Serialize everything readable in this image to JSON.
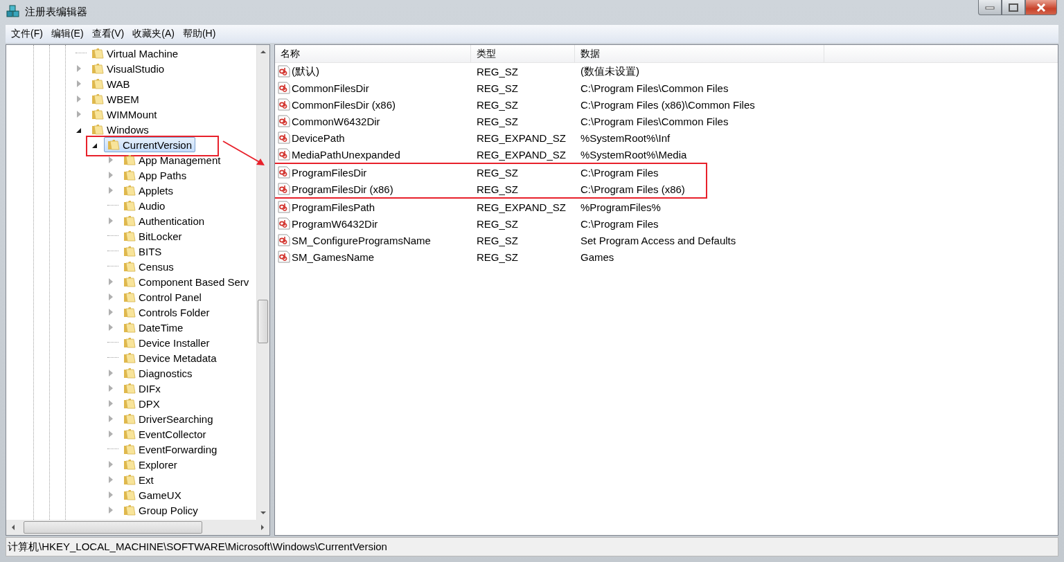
{
  "window": {
    "title": "注册表编辑器"
  },
  "menu": [
    "文件(F)",
    "编辑(E)",
    "查看(V)",
    "收藏夹(A)",
    "帮助(H)"
  ],
  "tree": [
    {
      "label": "Virtual Machine",
      "has_children": false,
      "selected": false,
      "marked": false
    },
    {
      "label": "VisualStudio",
      "has_children": true,
      "expanded": false,
      "selected": false,
      "marked": false
    },
    {
      "label": "WAB",
      "has_children": true,
      "expanded": false,
      "selected": false,
      "marked": false
    },
    {
      "label": "WBEM",
      "has_children": true,
      "expanded": false,
      "selected": false,
      "marked": false
    },
    {
      "label": "WIMMount",
      "has_children": true,
      "expanded": false,
      "selected": false,
      "marked": false
    },
    {
      "label": "Windows",
      "has_children": true,
      "expanded": true,
      "selected": false,
      "marked": false,
      "children": [
        {
          "label": "CurrentVersion",
          "has_children": true,
          "expanded": true,
          "selected": true,
          "marked": true,
          "children": [
            {
              "label": "App Management",
              "has_children": true,
              "expanded": false,
              "selected": false,
              "marked": false
            },
            {
              "label": "App Paths",
              "has_children": true,
              "expanded": false,
              "selected": false,
              "marked": false
            },
            {
              "label": "Applets",
              "has_children": true,
              "expanded": false,
              "selected": false,
              "marked": false
            },
            {
              "label": "Audio",
              "has_children": false,
              "selected": false,
              "marked": false
            },
            {
              "label": "Authentication",
              "has_children": true,
              "expanded": false,
              "selected": false,
              "marked": false
            },
            {
              "label": "BitLocker",
              "has_children": false,
              "selected": false,
              "marked": false
            },
            {
              "label": "BITS",
              "has_children": false,
              "selected": false,
              "marked": false
            },
            {
              "label": "Census",
              "has_children": false,
              "selected": false,
              "marked": false
            },
            {
              "label": "Component Based Serv",
              "has_children": true,
              "expanded": false,
              "selected": false,
              "marked": false
            },
            {
              "label": "Control Panel",
              "has_children": true,
              "expanded": false,
              "selected": false,
              "marked": false
            },
            {
              "label": "Controls Folder",
              "has_children": true,
              "expanded": false,
              "selected": false,
              "marked": false
            },
            {
              "label": "DateTime",
              "has_children": true,
              "expanded": false,
              "selected": false,
              "marked": false
            },
            {
              "label": "Device Installer",
              "has_children": false,
              "selected": false,
              "marked": false
            },
            {
              "label": "Device Metadata",
              "has_children": false,
              "selected": false,
              "marked": false
            },
            {
              "label": "Diagnostics",
              "has_children": true,
              "expanded": false,
              "selected": false,
              "marked": false
            },
            {
              "label": "DIFx",
              "has_children": true,
              "expanded": false,
              "selected": false,
              "marked": false
            },
            {
              "label": "DPX",
              "has_children": true,
              "expanded": false,
              "selected": false,
              "marked": false
            },
            {
              "label": "DriverSearching",
              "has_children": true,
              "expanded": false,
              "selected": false,
              "marked": false
            },
            {
              "label": "EventCollector",
              "has_children": true,
              "expanded": false,
              "selected": false,
              "marked": false
            },
            {
              "label": "EventForwarding",
              "has_children": false,
              "selected": false,
              "marked": false
            },
            {
              "label": "Explorer",
              "has_children": true,
              "expanded": false,
              "selected": false,
              "marked": false
            },
            {
              "label": "Ext",
              "has_children": true,
              "expanded": false,
              "selected": false,
              "marked": false
            },
            {
              "label": "GameUX",
              "has_children": true,
              "expanded": false,
              "selected": false,
              "marked": false
            },
            {
              "label": "Group Policy",
              "has_children": true,
              "expanded": false,
              "selected": false,
              "marked": false
            }
          ]
        }
      ]
    }
  ],
  "table": {
    "columns": [
      "名称",
      "类型",
      "数据"
    ],
    "rows": [
      {
        "name": "(默认)",
        "type": "REG_SZ",
        "data": "(数值未设置)",
        "marked": false
      },
      {
        "name": "CommonFilesDir",
        "type": "REG_SZ",
        "data": "C:\\Program Files\\Common Files",
        "marked": false
      },
      {
        "name": "CommonFilesDir (x86)",
        "type": "REG_SZ",
        "data": "C:\\Program Files (x86)\\Common Files",
        "marked": false
      },
      {
        "name": "CommonW6432Dir",
        "type": "REG_SZ",
        "data": "C:\\Program Files\\Common Files",
        "marked": false
      },
      {
        "name": "DevicePath",
        "type": "REG_EXPAND_SZ",
        "data": "%SystemRoot%\\Inf",
        "marked": false
      },
      {
        "name": "MediaPathUnexpanded",
        "type": "REG_EXPAND_SZ",
        "data": "%SystemRoot%\\Media",
        "marked": false
      },
      {
        "name": "ProgramFilesDir",
        "type": "REG_SZ",
        "data": "C:\\Program Files",
        "marked": true
      },
      {
        "name": "ProgramFilesDir (x86)",
        "type": "REG_SZ",
        "data": "C:\\Program Files (x86)",
        "marked": true
      },
      {
        "name": "ProgramFilesPath",
        "type": "REG_EXPAND_SZ",
        "data": "%ProgramFiles%",
        "marked": false
      },
      {
        "name": "ProgramW6432Dir",
        "type": "REG_SZ",
        "data": "C:\\Program Files",
        "marked": false
      },
      {
        "name": "SM_ConfigureProgramsName",
        "type": "REG_SZ",
        "data": "Set Program Access and Defaults",
        "marked": false
      },
      {
        "name": "SM_GamesName",
        "type": "REG_SZ",
        "data": "Games",
        "marked": false
      }
    ]
  },
  "status_bar": "计算机\\HKEY_LOCAL_MACHINE\\SOFTWARE\\Microsoft\\Windows\\CurrentVersion"
}
